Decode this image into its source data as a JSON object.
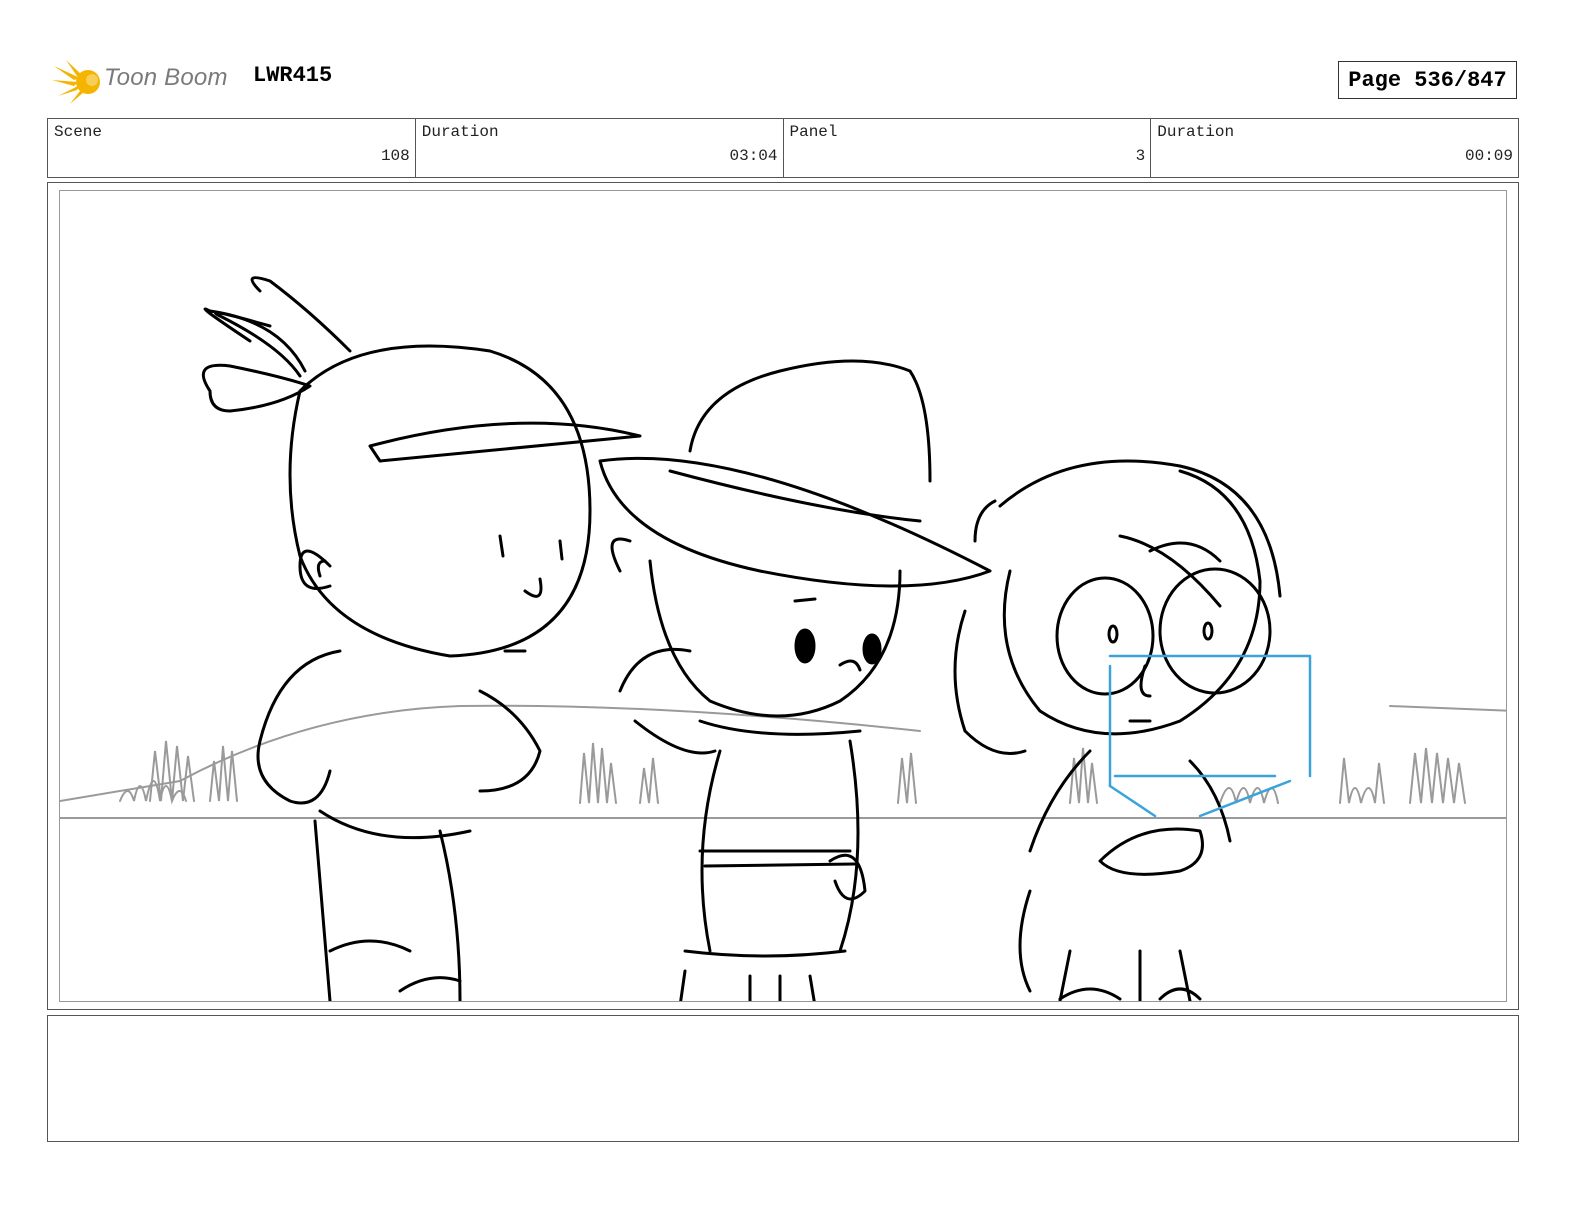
{
  "header": {
    "logo_text": "Toon Boom",
    "project_id": "LWR415",
    "page_label": "Page 536/847"
  },
  "info": {
    "scene_label": "Scene",
    "scene_value": "108",
    "scene_duration_label": "Duration",
    "scene_duration_value": "03:04",
    "panel_label": "Panel",
    "panel_value": "3",
    "panel_duration_label": "Duration",
    "panel_duration_value": "00:09"
  },
  "notes": {
    "text": ""
  },
  "colors": {
    "logo_yellow": "#f5b400",
    "logo_text_gray": "#7a7a7a",
    "sketch_line": "#000000",
    "background_sketch": "#9a9a9a",
    "camera_guide_blue": "#3ba3d9"
  }
}
